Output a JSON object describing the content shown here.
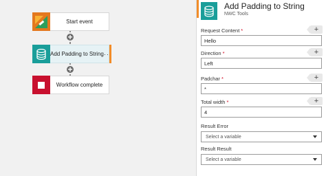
{
  "workflow": {
    "nodes": [
      {
        "label": "Start event"
      },
      {
        "label": "Add Padding to String",
        "more": "···"
      },
      {
        "label": "Workflow complete"
      }
    ]
  },
  "panel": {
    "title": "Add Padding to String",
    "subtitle": "NWC Tools",
    "fields": {
      "request_content": {
        "label": "Request Content",
        "required": "*",
        "value": "Hello"
      },
      "direction": {
        "label": "Direction",
        "required": "*",
        "value": "Left"
      },
      "padchar": {
        "label": "Padchar",
        "required": "*",
        "value": "*"
      },
      "total_width": {
        "label": "Total width",
        "required": "*",
        "value": "4"
      },
      "result_error": {
        "label": "Result Error",
        "placeholder": "Select a variable"
      },
      "result_result": {
        "label": "Result Result",
        "placeholder": "Select a variable"
      }
    }
  },
  "colors": {
    "start_tile": "#e4781e",
    "action_tile": "#1a9e9a",
    "complete_tile": "#c8102e",
    "selection_accent": "#f28c28",
    "required": "#d0021b"
  },
  "icons": [
    "start-event-icon",
    "database-icon",
    "stop-icon",
    "plus-icon",
    "chevron-down-icon"
  ]
}
